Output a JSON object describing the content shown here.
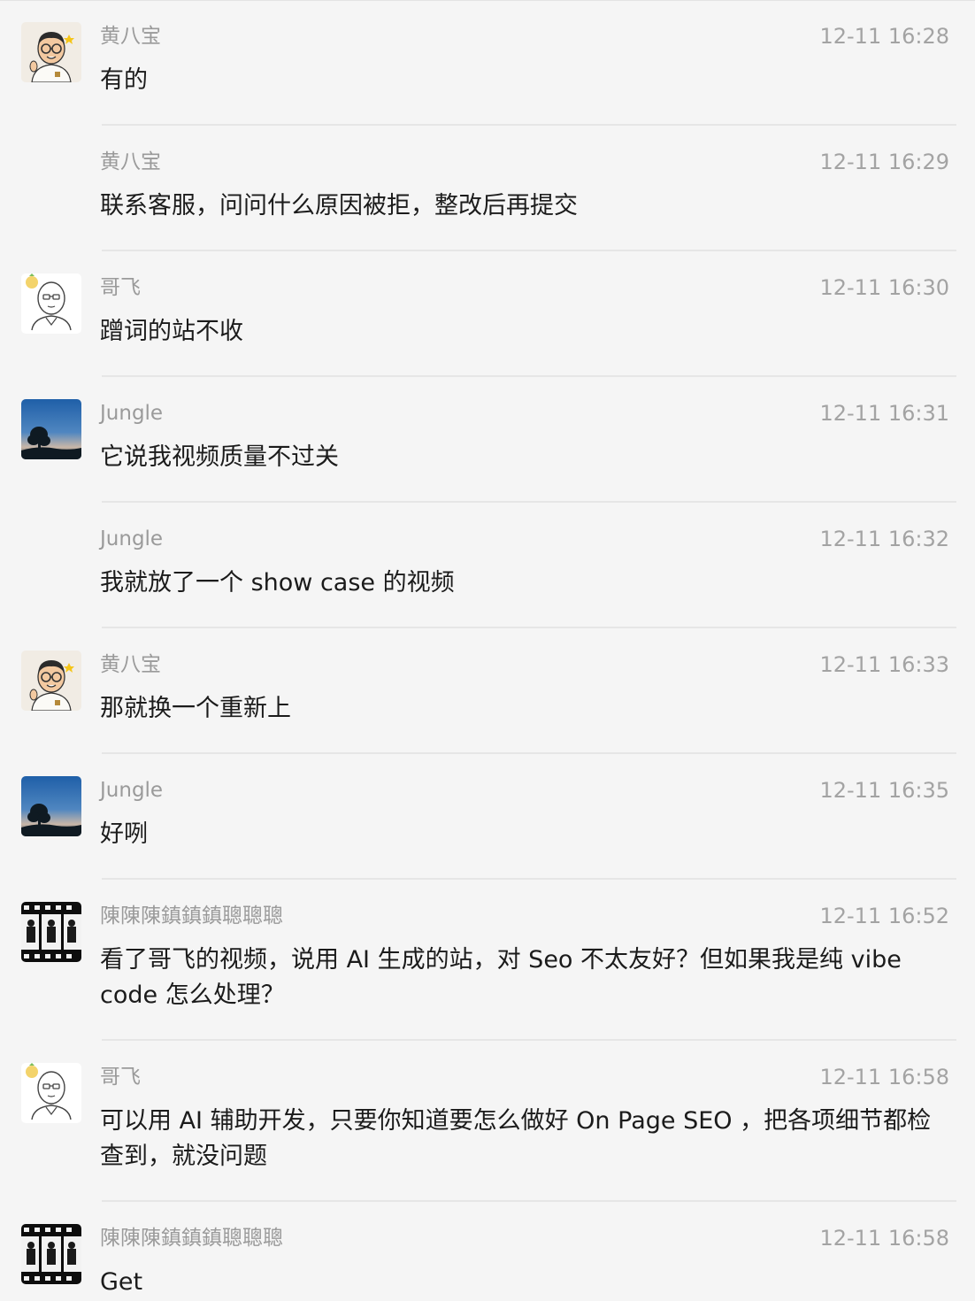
{
  "messages": [
    {
      "sender": "黄八宝",
      "time": "12-11 16:28",
      "text": "有的",
      "avatar": "huang-avatar",
      "showAvatar": true
    },
    {
      "sender": "黄八宝",
      "time": "12-11 16:29",
      "text": "联系客服，问问什么原因被拒，整改后再提交",
      "avatar": "huang-avatar",
      "showAvatar": false
    },
    {
      "sender": "哥飞",
      "time": "12-11 16:30",
      "text": "蹭词的站不收",
      "avatar": "gefei-avatar",
      "showAvatar": true
    },
    {
      "sender": "Jungle",
      "time": "12-11 16:31",
      "text": "它说我视频质量不过关",
      "avatar": "jungle-avatar",
      "showAvatar": true
    },
    {
      "sender": "Jungle",
      "time": "12-11 16:32",
      "text": "我就放了一个 show case 的视频",
      "avatar": "jungle-avatar",
      "showAvatar": false
    },
    {
      "sender": "黄八宝",
      "time": "12-11 16:33",
      "text": "那就换一个重新上",
      "avatar": "huang-avatar",
      "showAvatar": true
    },
    {
      "sender": "Jungle",
      "time": "12-11 16:35",
      "text": "好咧",
      "avatar": "jungle-avatar",
      "showAvatar": true
    },
    {
      "sender": "陳陳陳鎮鎮鎮聰聰聰",
      "time": "12-11 16:52",
      "text": "看了哥飞的视频，说用 AI 生成的站，对 Seo 不太友好？但如果我是纯 vibe code 怎么处理？",
      "avatar": "chen-avatar",
      "showAvatar": true
    },
    {
      "sender": "哥飞",
      "time": "12-11 16:58",
      "text": "可以用 AI 辅助开发，只要你知道要怎么做好 On Page SEO ，把各项细节都检查到，就没问题",
      "avatar": "gefei-avatar",
      "showAvatar": true
    },
    {
      "sender": "陳陳陳鎮鎮鎮聰聰聰",
      "time": "12-11 16:58",
      "text": "Get",
      "avatar": "chen-avatar",
      "showAvatar": true
    }
  ]
}
